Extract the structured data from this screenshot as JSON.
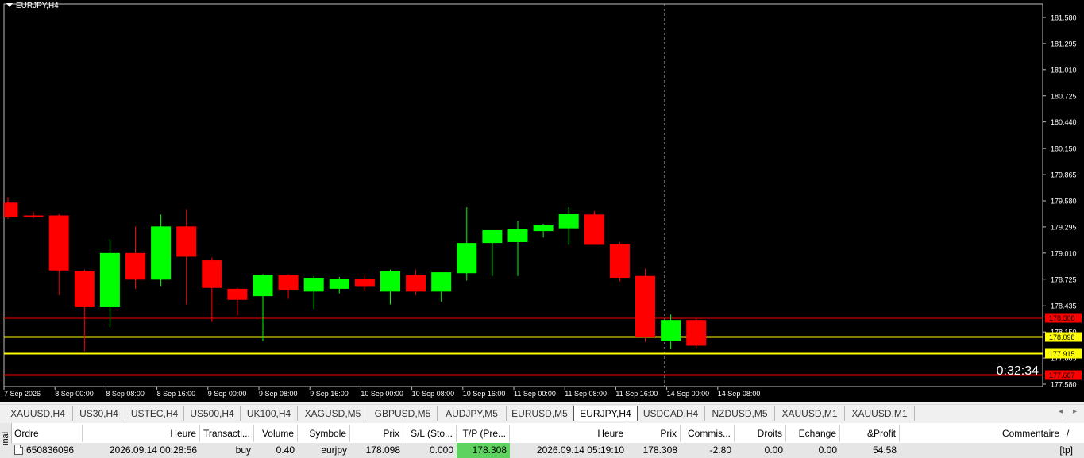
{
  "chart": {
    "title": "EURJPY,H4",
    "timer": "0:32:34",
    "y_ticks": [
      "181.580",
      "181.295",
      "181.010",
      "180.725",
      "180.440",
      "180.150",
      "179.865",
      "179.580",
      "179.295",
      "179.010",
      "178.725",
      "178.435",
      "178.150",
      "177.865",
      "177.580"
    ],
    "x_ticks": [
      "7 Sep 2026",
      "8 Sep 00:00",
      "8 Sep 08:00",
      "8 Sep 16:00",
      "9 Sep 00:00",
      "9 Sep 08:00",
      "9 Sep 16:00",
      "10 Sep 00:00",
      "10 Sep 08:00",
      "10 Sep 16:00",
      "11 Sep 00:00",
      "11 Sep 08:00",
      "11 Sep 16:00",
      "14 Sep 00:00",
      "14 Sep 08:00"
    ],
    "levels": [
      {
        "price": 178.308,
        "label": "178.308",
        "color": "#ff0000",
        "label_bg": "#ff0000",
        "label_color": "#000000"
      },
      {
        "price": 178.098,
        "label": "178.098",
        "color": "#ffff00",
        "label_bg": "#ffff00",
        "label_color": "#000000"
      },
      {
        "price": 177.915,
        "label": "177.915",
        "color": "#ffff00",
        "label_bg": "#ffff00",
        "label_color": "#000000"
      },
      {
        "price": 177.687,
        "label": "177.687",
        "color": "#ff0000",
        "label_bg": "#ff0000",
        "label_color": "#000000"
      }
    ],
    "colors": {
      "bull": "#00ff00",
      "bear": "#ff0000",
      "background": "#000000",
      "grid_text": "#ffffff"
    }
  },
  "chart_data": {
    "type": "candlestick",
    "title": "EURJPY,H4",
    "ylim": [
      177.58,
      181.58
    ],
    "x": [
      "7 Sep 2026",
      "8 Sep 00:00",
      "8 Sep 04:00",
      "8 Sep 08:00",
      "8 Sep 12:00",
      "8 Sep 16:00",
      "8 Sep 20:00",
      "9 Sep 00:00",
      "9 Sep 04:00",
      "9 Sep 08:00",
      "9 Sep 12:00",
      "9 Sep 16:00",
      "9 Sep 20:00",
      "10 Sep 00:00",
      "10 Sep 04:00",
      "10 Sep 08:00",
      "10 Sep 12:00",
      "10 Sep 16:00",
      "10 Sep 20:00",
      "11 Sep 00:00",
      "11 Sep 04:00",
      "11 Sep 08:00",
      "11 Sep 12:00",
      "11 Sep 16:00",
      "11 Sep 20:00",
      "14 Sep 00:00",
      "14 Sep 04:00",
      "14 Sep 08:00"
    ],
    "candles": [
      {
        "o": 179.56,
        "h": 179.62,
        "l": 179.38,
        "c": 179.4
      },
      {
        "o": 179.42,
        "h": 179.46,
        "l": 179.39,
        "c": 179.41
      },
      {
        "o": 179.42,
        "h": 179.44,
        "l": 178.55,
        "c": 178.82
      },
      {
        "o": 178.81,
        "h": 178.83,
        "l": 177.94,
        "c": 178.42
      },
      {
        "o": 178.42,
        "h": 179.16,
        "l": 178.2,
        "c": 179.01
      },
      {
        "o": 179.01,
        "h": 179.3,
        "l": 178.62,
        "c": 178.72
      },
      {
        "o": 178.72,
        "h": 179.43,
        "l": 178.65,
        "c": 179.3
      },
      {
        "o": 179.3,
        "h": 179.49,
        "l": 178.45,
        "c": 178.97
      },
      {
        "o": 178.93,
        "h": 178.96,
        "l": 178.26,
        "c": 178.63
      },
      {
        "o": 178.62,
        "h": 178.63,
        "l": 178.33,
        "c": 178.5
      },
      {
        "o": 178.54,
        "h": 178.78,
        "l": 178.05,
        "c": 178.77
      },
      {
        "o": 178.77,
        "h": 178.78,
        "l": 178.51,
        "c": 178.61
      },
      {
        "o": 178.59,
        "h": 178.76,
        "l": 178.4,
        "c": 178.74
      },
      {
        "o": 178.62,
        "h": 178.75,
        "l": 178.57,
        "c": 178.73
      },
      {
        "o": 178.73,
        "h": 178.76,
        "l": 178.6,
        "c": 178.65
      },
      {
        "o": 178.59,
        "h": 178.83,
        "l": 178.45,
        "c": 178.81
      },
      {
        "o": 178.77,
        "h": 178.83,
        "l": 178.55,
        "c": 178.59
      },
      {
        "o": 178.59,
        "h": 178.8,
        "l": 178.48,
        "c": 178.8
      },
      {
        "o": 178.79,
        "h": 179.51,
        "l": 178.71,
        "c": 179.12
      },
      {
        "o": 179.12,
        "h": 179.22,
        "l": 178.76,
        "c": 179.26
      },
      {
        "o": 179.13,
        "h": 179.36,
        "l": 178.76,
        "c": 179.27
      },
      {
        "o": 179.25,
        "h": 179.33,
        "l": 179.18,
        "c": 179.32
      },
      {
        "o": 179.28,
        "h": 179.51,
        "l": 179.1,
        "c": 179.44
      },
      {
        "o": 179.43,
        "h": 179.47,
        "l": 179.11,
        "c": 179.1
      },
      {
        "o": 179.11,
        "h": 179.13,
        "l": 178.7,
        "c": 178.74
      },
      {
        "o": 178.76,
        "h": 178.84,
        "l": 178.04,
        "c": 178.09
      },
      {
        "o": 178.05,
        "h": 178.34,
        "l": 177.96,
        "c": 178.28
      },
      {
        "o": 178.28,
        "h": 178.3,
        "l": 177.97,
        "c": 178.0
      }
    ]
  },
  "tabs": [
    {
      "label": "XAUUSD,H4",
      "active": false
    },
    {
      "label": "US30,H4",
      "active": false
    },
    {
      "label": "USTEC,H4",
      "active": false
    },
    {
      "label": "US500,H4",
      "active": false
    },
    {
      "label": "UK100,H4",
      "active": false
    },
    {
      "label": "XAGUSD,M5",
      "active": false
    },
    {
      "label": "GBPUSD,M5",
      "active": false
    },
    {
      "label": "AUDJPY,M5",
      "active": false
    },
    {
      "label": "EURUSD,M5",
      "active": false
    },
    {
      "label": "EURJPY,H4",
      "active": true
    },
    {
      "label": "USDCAD,H4",
      "active": false
    },
    {
      "label": "NZDUSD,M5",
      "active": false
    },
    {
      "label": "XAUUSD,M1",
      "active": false
    },
    {
      "label": "XAUUSD,M1",
      "active": false
    }
  ],
  "tab_nav": {
    "left": "◂",
    "right": "▸"
  },
  "terminal": {
    "side_label": "inal",
    "headers": {
      "order": "Ordre",
      "time": "Heure",
      "type": "Transacti...",
      "volume": "Volume",
      "symbol": "Symbole",
      "price": "Prix",
      "sl": "S/L (Sto...",
      "tp": "T/P (Pre...",
      "time2": "Heure",
      "price2": "Prix",
      "commission": "Commis...",
      "fees": "Droits",
      "swap": "Echange",
      "profit": "&Profit",
      "comment": "Commentaire",
      "sort": "/"
    },
    "row": {
      "order": "650836096",
      "time": "2026.09.14 00:28:56",
      "type": "buy",
      "volume": "0.40",
      "symbol": "eurjpy",
      "price": "178.098",
      "sl": "0.000",
      "tp": "178.308",
      "time2": "2026.09.14 05:19:10",
      "price2": "178.308",
      "commission": "-2.80",
      "fees": "0.00",
      "swap": "0.00",
      "profit": "54.58",
      "comment": "[tp]"
    }
  }
}
